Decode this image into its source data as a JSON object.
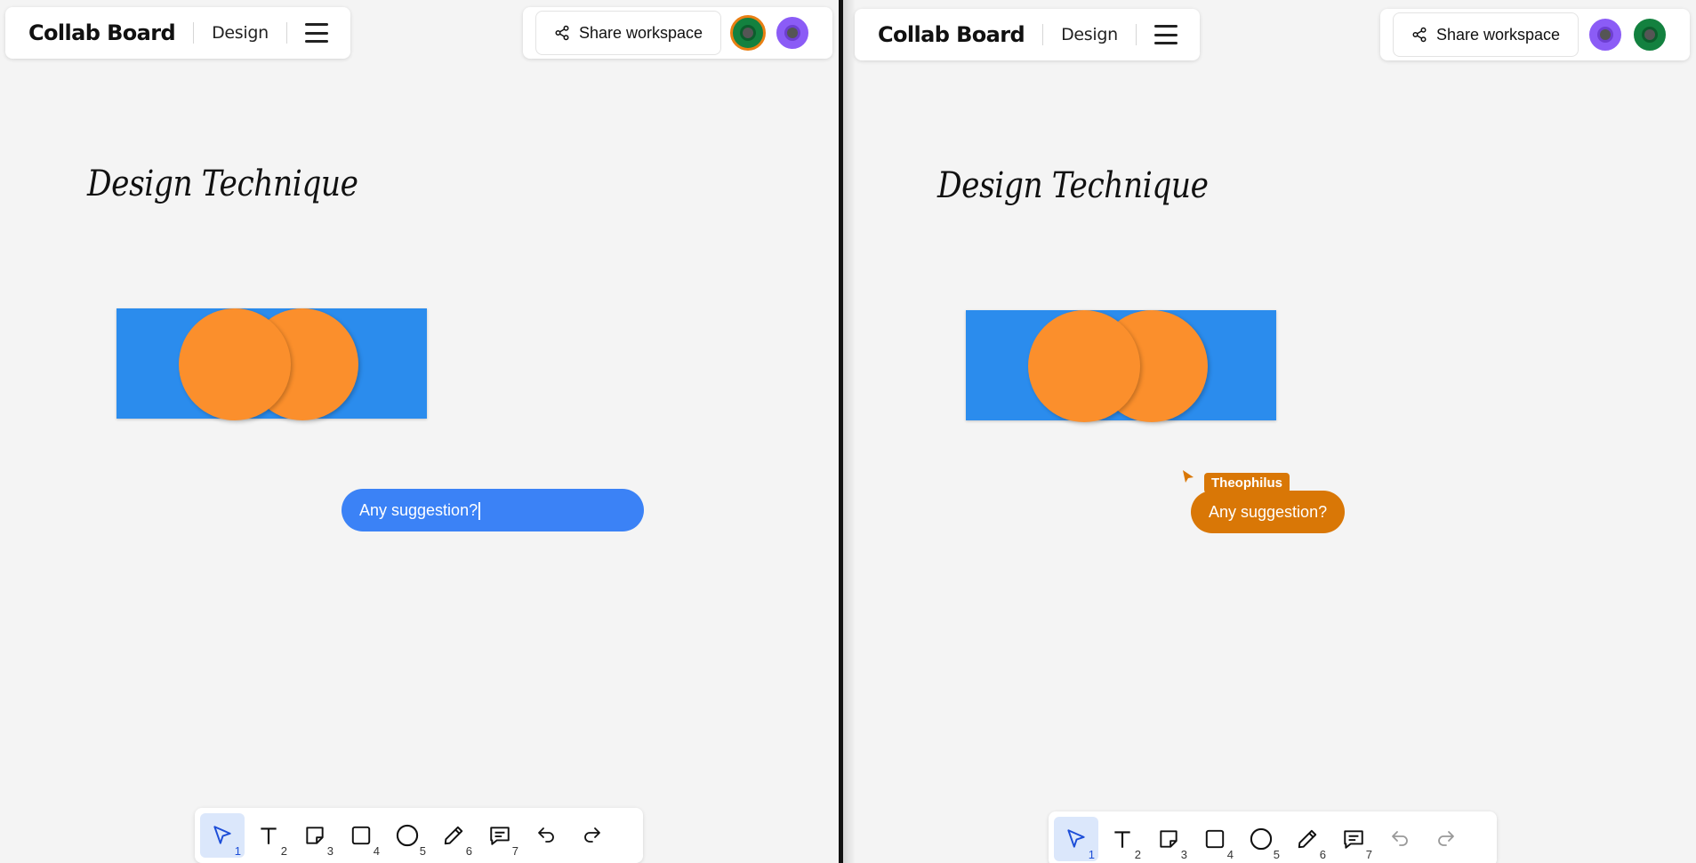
{
  "app": {
    "title": "Collab Board",
    "board_name": "Design"
  },
  "header": {
    "share_label": "Share workspace"
  },
  "canvas": {
    "heading": "Design Technique"
  },
  "left_pane": {
    "avatars": [
      {
        "name": "green-avatar",
        "color": "#13813f",
        "ring": "#e97f13"
      },
      {
        "name": "purple-avatar",
        "color": "#8b5cf6",
        "ring": "#ffffff"
      }
    ],
    "comment_input_value": "Any suggestion?"
  },
  "right_pane": {
    "avatars": [
      {
        "name": "purple-avatar",
        "color": "#8b5cf6",
        "ring": "#ffffff"
      },
      {
        "name": "green-avatar",
        "color": "#13813f",
        "ring": "#ffffff"
      }
    ],
    "remote_user": "Theophilus",
    "remote_comment": "Any suggestion?"
  },
  "toolbar": {
    "tools": [
      {
        "name": "select",
        "shortcut": "1"
      },
      {
        "name": "text",
        "shortcut": "2"
      },
      {
        "name": "sticky-note",
        "shortcut": "3"
      },
      {
        "name": "rectangle",
        "shortcut": "4"
      },
      {
        "name": "ellipse",
        "shortcut": "5"
      },
      {
        "name": "pencil",
        "shortcut": "6"
      },
      {
        "name": "comment",
        "shortcut": "7"
      },
      {
        "name": "undo",
        "shortcut": ""
      },
      {
        "name": "redo",
        "shortcut": ""
      }
    ],
    "active_tool": "select"
  },
  "colors": {
    "rect_fill": "#2b8ced",
    "circle_fill": "#fb8f2c",
    "comment_blue": "#3b82f6",
    "remote_orange": "#d97706",
    "active_tool_bg": "#dbe7fb"
  }
}
